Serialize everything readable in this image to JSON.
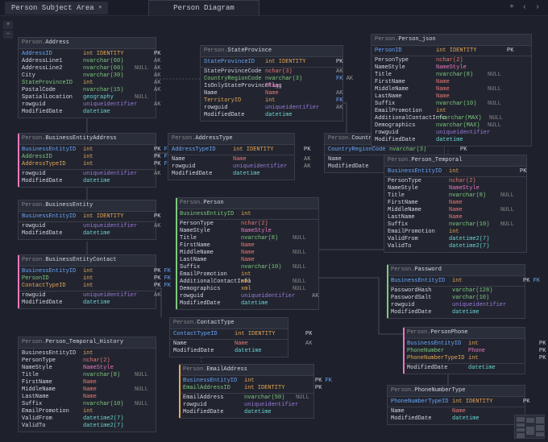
{
  "topbar": {
    "dropdown_label": "Person Subject Area",
    "tab_label": "Person Diagram",
    "icons": {
      "plus": "+",
      "left": "‹",
      "right": "›"
    }
  },
  "tools": {
    "plus": "+",
    "minus": "−"
  },
  "tables": {
    "address": {
      "schema": "Person.",
      "name": "Address",
      "rows": [
        [
          "AddressID",
          "int IDENTITY",
          "",
          "PK",
          "blue",
          "orange"
        ],
        [
          "AddressLine1",
          "nvarchar(60)",
          "",
          "AK",
          "white",
          "green"
        ],
        [
          "AddressLine2",
          "nvarchar(60)",
          "NULL",
          "AK",
          "white",
          "green"
        ],
        [
          "City",
          "nvarchar(30)",
          "",
          "AK",
          "white",
          "green"
        ],
        [
          "StateProvinceID",
          "int",
          "",
          "AK",
          "green",
          "orange"
        ],
        [
          "PostalCode",
          "nvarchar(15)",
          "",
          "AK",
          "white",
          "green"
        ],
        [
          "SpatialLocation",
          "geography",
          "NULL",
          "",
          "white",
          "cyan"
        ],
        [
          "rowguid",
          "uniqueidentifier",
          "",
          "AK",
          "white",
          "ident"
        ],
        [
          "ModifiedDate",
          "datetime",
          "",
          "",
          "white",
          "cyan"
        ]
      ]
    },
    "bea": {
      "schema": "Person.",
      "name": "BusinessEntityAddress",
      "rows": [
        [
          "BusinessEntityID",
          "int",
          "",
          "PK FK",
          "blue",
          "orange"
        ],
        [
          "AddressID",
          "int",
          "",
          "PK FK",
          "green",
          "orange"
        ],
        [
          "AddressTypeID",
          "int",
          "",
          "PK FK",
          "orange",
          "orange"
        ],
        [
          "-",
          "",
          "",
          "",
          "",
          ""
        ],
        [
          "rowguid",
          "uniqueidentifier",
          "",
          "AK",
          "white",
          "ident"
        ],
        [
          "ModifiedDate",
          "datetime",
          "",
          "",
          "white",
          "cyan"
        ]
      ]
    },
    "be": {
      "schema": "Person.",
      "name": "BusinessEntity",
      "rows": [
        [
          "BusinessEntityID",
          "int IDENTITY",
          "",
          "PK",
          "blue",
          "orange"
        ],
        [
          "-",
          "",
          "",
          "",
          "",
          ""
        ],
        [
          "rowguid",
          "uniqueidentifier",
          "",
          "AK",
          "white",
          "ident"
        ],
        [
          "ModifiedDate",
          "datetime",
          "",
          "",
          "white",
          "cyan"
        ]
      ]
    },
    "bec": {
      "schema": "Person.",
      "name": "BusinessEntityContact",
      "rows": [
        [
          "BusinessEntityID",
          "int",
          "",
          "PK FK",
          "blue",
          "orange"
        ],
        [
          "PersonID",
          "int",
          "",
          "PK FK",
          "green",
          "orange"
        ],
        [
          "ContactTypeID",
          "int",
          "",
          "PK FK",
          "orange",
          "orange"
        ],
        [
          "-",
          "",
          "",
          "",
          "",
          ""
        ],
        [
          "rowguid",
          "uniqueidentifier",
          "",
          "AK",
          "white",
          "ident"
        ],
        [
          "ModifiedDate",
          "datetime",
          "",
          "",
          "white",
          "cyan"
        ]
      ]
    },
    "pth": {
      "schema": "Person.",
      "name": "Person_Temporal_History",
      "rows": [
        [
          "BusinessEntityID",
          "int",
          "",
          "",
          "white",
          "orange"
        ],
        [
          "PersonType",
          "nchar(2)",
          "",
          "",
          "white",
          "red"
        ],
        [
          "NameStyle",
          "NameStyle",
          "",
          "",
          "white",
          "pink"
        ],
        [
          "Title",
          "nvarchar(8)",
          "NULL",
          "",
          "white",
          "green"
        ],
        [
          "FirstName",
          "Name",
          "",
          "",
          "white",
          "red"
        ],
        [
          "MiddleName",
          "Name",
          "NULL",
          "",
          "white",
          "red"
        ],
        [
          "LastName",
          "Name",
          "",
          "",
          "white",
          "red"
        ],
        [
          "Suffix",
          "nvarchar(10)",
          "NULL",
          "",
          "white",
          "green"
        ],
        [
          "EmailPromotion",
          "int",
          "",
          "",
          "white",
          "orange"
        ],
        [
          "ValidFrom",
          "datetime2(7)",
          "",
          "",
          "white",
          "cyan"
        ],
        [
          "ValidTo",
          "datetime2(7)",
          "",
          "",
          "white",
          "cyan"
        ]
      ]
    },
    "sp": {
      "schema": "Person.",
      "name": "StateProvince",
      "rows": [
        [
          "StateProvinceID",
          "int IDENTITY",
          "",
          "PK",
          "blue",
          "orange"
        ],
        [
          "-",
          "",
          "",
          "",
          "",
          ""
        ],
        [
          "StateProvinceCode",
          "nchar(3)",
          "",
          "AK",
          "white",
          "red"
        ],
        [
          "CountryRegionCode",
          "nvarchar(3)",
          "",
          "FK AK",
          "green",
          "green"
        ],
        [
          "IsOnlyStateProvinceFlag",
          "Flag",
          "",
          "",
          "white",
          "pink"
        ],
        [
          "Name",
          "Name",
          "",
          "AK",
          "white",
          "red"
        ],
        [
          "TerritoryID",
          "int",
          "",
          "FK",
          "orange",
          "orange"
        ],
        [
          "rowguid",
          "uniqueidentifier",
          "",
          "AK",
          "white",
          "ident"
        ],
        [
          "ModifiedDate",
          "datetime",
          "",
          "",
          "white",
          "cyan"
        ]
      ]
    },
    "at": {
      "schema": "Person.",
      "name": "AddressType",
      "rows": [
        [
          "AddressTypeID",
          "int IDENTITY",
          "",
          "PK",
          "blue",
          "orange"
        ],
        [
          "-",
          "",
          "",
          "",
          "",
          ""
        ],
        [
          "Name",
          "Name",
          "",
          "AK",
          "white",
          "red"
        ],
        [
          "rowguid",
          "uniqueidentifier",
          "",
          "AK",
          "white",
          "ident"
        ],
        [
          "ModifiedDate",
          "datetime",
          "",
          "",
          "white",
          "cyan"
        ]
      ]
    },
    "person": {
      "schema": "Person.",
      "name": "Person",
      "rows": [
        [
          "BusinessEntityID",
          "int",
          "",
          "",
          "green",
          "orange"
        ],
        [
          "-",
          "",
          "",
          "",
          "",
          ""
        ],
        [
          "PersonType",
          "nchar(2)",
          "",
          "",
          "white",
          "red"
        ],
        [
          "NameStyle",
          "NameStyle",
          "",
          "",
          "white",
          "pink"
        ],
        [
          "Title",
          "nvarchar(8)",
          "NULL",
          "",
          "white",
          "green"
        ],
        [
          "FirstName",
          "Name",
          "",
          "",
          "white",
          "red"
        ],
        [
          "MiddleName",
          "Name",
          "NULL",
          "",
          "white",
          "red"
        ],
        [
          "LastName",
          "Name",
          "",
          "",
          "white",
          "red"
        ],
        [
          "Suffix",
          "nvarchar(10)",
          "NULL",
          "",
          "white",
          "green"
        ],
        [
          "EmailPromotion",
          "int",
          "",
          "",
          "white",
          "orange"
        ],
        [
          "AdditionalContactInfo",
          "xml",
          "NULL",
          "",
          "white",
          "orange"
        ],
        [
          "Demographics",
          "xml",
          "NULL",
          "",
          "white",
          "orange"
        ],
        [
          "rowguid",
          "uniqueidentifier",
          "",
          "AK",
          "white",
          "ident"
        ],
        [
          "ModifiedDate",
          "datetime",
          "",
          "",
          "white",
          "cyan"
        ]
      ]
    },
    "ct": {
      "schema": "Person.",
      "name": "ContactType",
      "rows": [
        [
          "ContactTypeID",
          "int IDENTITY",
          "",
          "PK",
          "blue",
          "orange"
        ],
        [
          "-",
          "",
          "",
          "",
          "",
          ""
        ],
        [
          "Name",
          "Name",
          "",
          "AK",
          "white",
          "red"
        ],
        [
          "ModifiedDate",
          "datetime",
          "",
          "",
          "white",
          "cyan"
        ]
      ]
    },
    "ea": {
      "schema": "Person.",
      "name": "EmailAddress",
      "rows": [
        [
          "BusinessEntityID",
          "int",
          "",
          "PK FK",
          "blue",
          "orange"
        ],
        [
          "EmailAddressID",
          "int IDENTITY",
          "",
          "PK",
          "green",
          "orange"
        ],
        [
          "-",
          "",
          "",
          "",
          "",
          ""
        ],
        [
          "EmailAddress",
          "nvarchar(50)",
          "NULL",
          "",
          "white",
          "green"
        ],
        [
          "rowguid",
          "uniqueidentifier",
          "",
          "",
          "white",
          "ident"
        ],
        [
          "ModifiedDate",
          "datetime",
          "",
          "",
          "white",
          "cyan"
        ]
      ]
    },
    "cr": {
      "schema": "Person.",
      "name": "CountryRegion",
      "rows": [
        [
          "CountryRegionCode",
          "nvarchar(3)",
          "",
          "PK",
          "blue",
          "green"
        ],
        [
          "-",
          "",
          "",
          "",
          "",
          ""
        ],
        [
          "Name",
          "Name",
          "",
          "AK",
          "white",
          "red"
        ],
        [
          "ModifiedDate",
          "datetime",
          "",
          "",
          "white",
          "cyan"
        ]
      ]
    },
    "pj": {
      "schema": "Person.",
      "name": "Person_json",
      "rows": [
        [
          "PersonID",
          "int IDENTITY",
          "",
          "PK",
          "blue",
          "orange"
        ],
        [
          "-",
          "",
          "",
          "",
          "",
          ""
        ],
        [
          "PersonType",
          "nchar(2)",
          "",
          "",
          "white",
          "red"
        ],
        [
          "NameStyle",
          "NameStyle",
          "",
          "",
          "white",
          "pink"
        ],
        [
          "Title",
          "nvarchar(8)",
          "NULL",
          "",
          "white",
          "green"
        ],
        [
          "FirstName",
          "Name",
          "",
          "",
          "white",
          "red"
        ],
        [
          "MiddleName",
          "Name",
          "NULL",
          "",
          "white",
          "red"
        ],
        [
          "LastName",
          "Name",
          "",
          "",
          "white",
          "red"
        ],
        [
          "Suffix",
          "nvarchar(10)",
          "NULL",
          "",
          "white",
          "green"
        ],
        [
          "EmailPromotion",
          "int",
          "",
          "",
          "white",
          "orange"
        ],
        [
          "AdditionalContactInfo",
          "nvarchar(MAX)",
          "NULL",
          "",
          "white",
          "green"
        ],
        [
          "Demographics",
          "nvarchar(MAX)",
          "NULL",
          "",
          "white",
          "green"
        ],
        [
          "rowguid",
          "uniqueidentifier",
          "",
          "",
          "white",
          "ident"
        ],
        [
          "ModifiedDate",
          "datetime",
          "",
          "",
          "white",
          "cyan"
        ]
      ]
    },
    "pt": {
      "schema": "Person.",
      "name": "Person_Temporal",
      "rows": [
        [
          "BusinessEntityID",
          "int",
          "",
          "PK",
          "blue",
          "orange"
        ],
        [
          "-",
          "",
          "",
          "",
          "",
          ""
        ],
        [
          "PersonType",
          "nchar(2)",
          "",
          "",
          "white",
          "red"
        ],
        [
          "NameStyle",
          "NameStyle",
          "",
          "",
          "white",
          "pink"
        ],
        [
          "Title",
          "nvarchar(8)",
          "NULL",
          "",
          "white",
          "green"
        ],
        [
          "FirstName",
          "Name",
          "",
          "",
          "white",
          "red"
        ],
        [
          "MiddleName",
          "Name",
          "NULL",
          "",
          "white",
          "red"
        ],
        [
          "LastName",
          "Name",
          "",
          "",
          "white",
          "red"
        ],
        [
          "Suffix",
          "nvarchar(10)",
          "NULL",
          "",
          "white",
          "green"
        ],
        [
          "EmailPromotion",
          "int",
          "",
          "",
          "white",
          "orange"
        ],
        [
          "ValidFrom",
          "datetime2(7)",
          "",
          "",
          "white",
          "cyan"
        ],
        [
          "ValidTo",
          "datetime2(7)",
          "",
          "",
          "white",
          "cyan"
        ]
      ]
    },
    "pw": {
      "schema": "Person.",
      "name": "Password",
      "rows": [
        [
          "BusinessEntityID",
          "int",
          "",
          "PK FK",
          "blue",
          "orange"
        ],
        [
          "-",
          "",
          "",
          "",
          "",
          ""
        ],
        [
          "PasswordHash",
          "varchar(128)",
          "",
          "",
          "white",
          "green"
        ],
        [
          "PasswordSalt",
          "varchar(10)",
          "",
          "",
          "white",
          "green"
        ],
        [
          "rowguid",
          "uniqueidentifier",
          "",
          "",
          "white",
          "ident"
        ],
        [
          "ModifiedDate",
          "datetime",
          "",
          "",
          "white",
          "cyan"
        ]
      ]
    },
    "pp": {
      "schema": "Person.",
      "name": "PersonPhone",
      "rows": [
        [
          "BusinessEntityID",
          "int",
          "",
          "PK FK",
          "blue",
          "orange"
        ],
        [
          "PhoneNumber",
          "Phone",
          "",
          "PK",
          "green",
          "pink"
        ],
        [
          "PhoneNumberTypeID",
          "int",
          "",
          "PK FK",
          "orange",
          "orange"
        ],
        [
          "-",
          "",
          "",
          "",
          "",
          ""
        ],
        [
          "ModifiedDate",
          "datetime",
          "",
          "",
          "white",
          "cyan"
        ]
      ]
    },
    "pnt": {
      "schema": "Person.",
      "name": "PhoneNumberType",
      "rows": [
        [
          "PhoneNumberTypeID",
          "int IDENTITY",
          "",
          "PK",
          "blue",
          "orange"
        ],
        [
          "-",
          "",
          "",
          "",
          "",
          ""
        ],
        [
          "Name",
          "Name",
          "",
          "",
          "white",
          "red"
        ],
        [
          "ModifiedDate",
          "datetime",
          "",
          "",
          "white",
          "cyan"
        ]
      ]
    }
  }
}
